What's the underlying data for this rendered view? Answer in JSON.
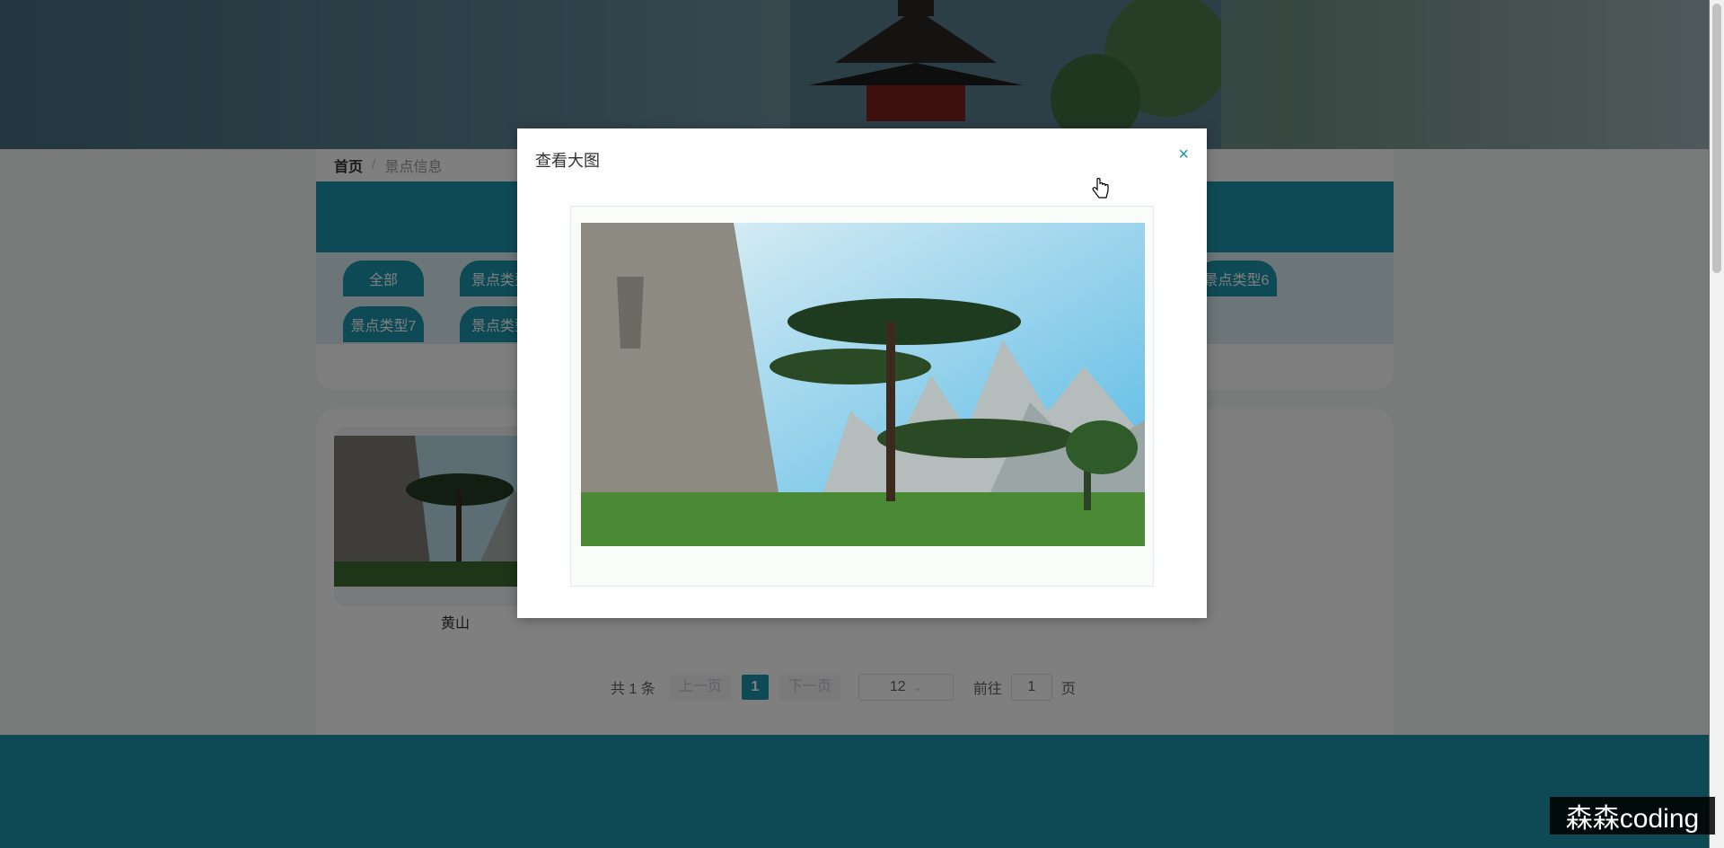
{
  "breadcrumb": {
    "home": "首页",
    "separator": "/",
    "current": "景点信息"
  },
  "filter": {
    "tags": [
      "全部",
      "景点类型",
      "景点类型6",
      "景点类型7",
      "景点类型"
    ]
  },
  "spots": [
    {
      "name": "黄山"
    }
  ],
  "pagination": {
    "total": "共 1 条",
    "prev": "上一页",
    "current_page": "1",
    "next": "下一页",
    "page_size": "12",
    "goto_label": "前往",
    "goto_value": "1",
    "page_suffix": "页"
  },
  "dialog": {
    "title": "查看大图",
    "close_icon": "close-icon"
  },
  "watermark": "森森coding",
  "colors": {
    "accent": "#1c95ab",
    "mask": "rgba(0,0,0,0.5)"
  }
}
